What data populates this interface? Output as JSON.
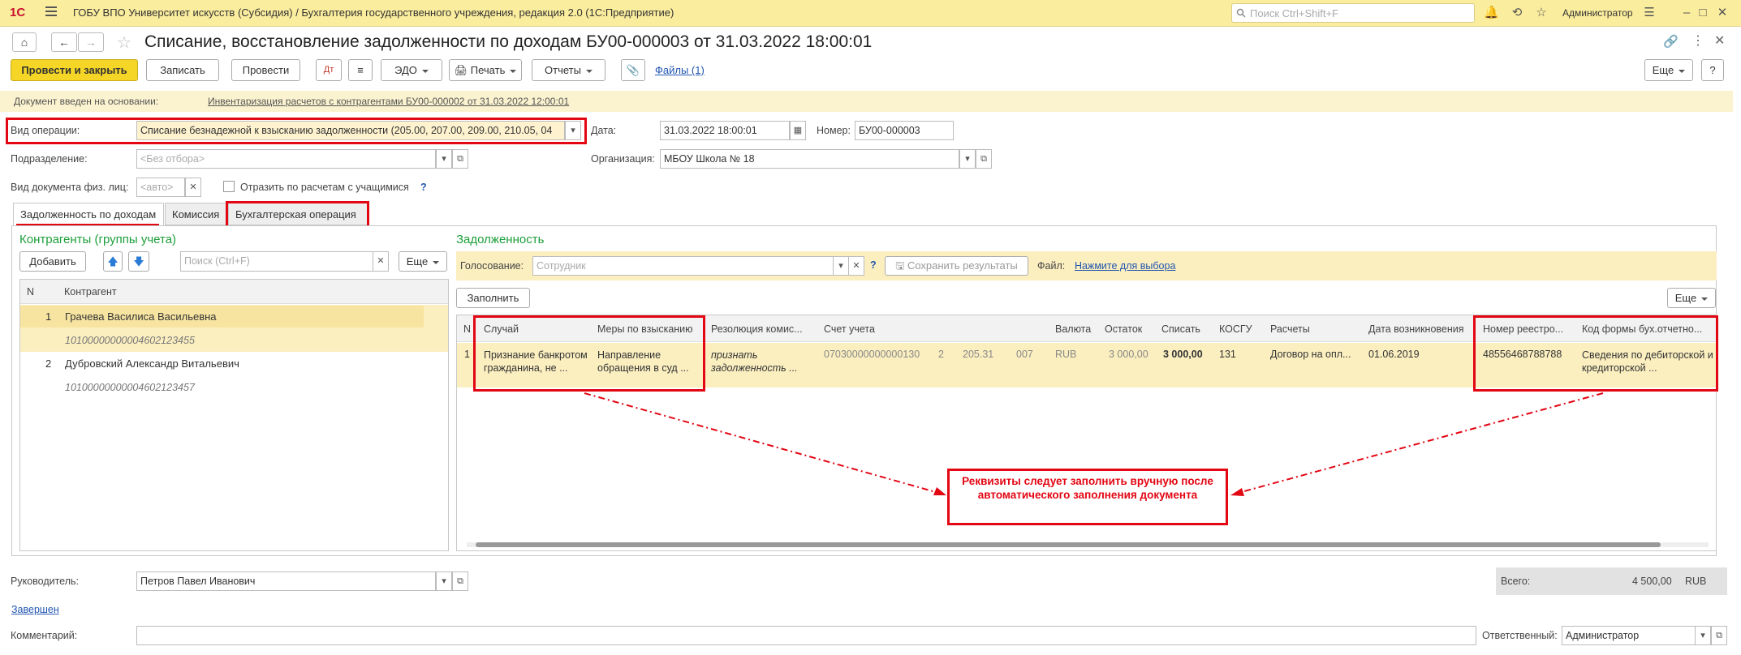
{
  "app": {
    "title": "ГОБУ ВПО Университет искусств (Субсидия) / Бухгалтерия государственного учреждения, редакция 2.0  (1С:Предприятие)",
    "logo": "1С",
    "search_placeholder": "Поиск Ctrl+Shift+F",
    "user": "Администратор"
  },
  "document": {
    "title": "Списание, восстановление задолженности по доходам БУ00-000003 от 31.03.2022 18:00:01"
  },
  "toolbar": {
    "post_close": "Провести и закрыть",
    "save": "Записать",
    "post": "Провести",
    "edo": "ЭДО",
    "print": "Печать",
    "reports": "Отчеты",
    "files": "Файлы (1)",
    "more": "Еще",
    "help": "?"
  },
  "basis": {
    "label": "Документ введен на основании:",
    "link": "Инвентаризация расчетов с контрагентами БУ00-000002 от 31.03.2022 12:00:01"
  },
  "form": {
    "operation_label": "Вид операции:",
    "operation_value": "Списание безнадежной к взысканию задолженности (205.00, 207.00, 209.00, 210.05, 04",
    "date_label": "Дата:",
    "date_value": "31.03.2022 18:00:01",
    "number_label": "Номер:",
    "number_value": "БУ00-000003",
    "division_label": "Подразделение:",
    "division_placeholder": "<Без отбора>",
    "org_label": "Организация:",
    "org_value": "МБОУ Школа № 18",
    "doctype_label": "Вид документа физ. лиц:",
    "doctype_placeholder": "<авто>",
    "reflect_label": "Отразить по расчетам с учащимися",
    "reflect_help": "?"
  },
  "tabs": [
    {
      "label": "Задолженность по доходам"
    },
    {
      "label": "Комиссия"
    },
    {
      "label": "Бухгалтерская операция"
    }
  ],
  "left": {
    "title": "Контрагенты (группы учета)",
    "add": "Добавить",
    "search_placeholder": "Поиск (Ctrl+F)",
    "more": "Еще",
    "col_n": "N",
    "col_contractor": "Контрагент",
    "rows": [
      {
        "n": "1",
        "name": "Грачева Василиса Васильевна",
        "code": "10100000000004602123455"
      },
      {
        "n": "2",
        "name": "Дубровский Александр Витальевич",
        "code": "10100000000004602123457"
      }
    ]
  },
  "right": {
    "title": "Задолженность",
    "voting_label": "Голосование:",
    "voting_placeholder": "Сотрудник",
    "save_results": "Сохранить результаты",
    "file_label": "Файл:",
    "file_link": "Нажмите для выбора",
    "fill": "Заполнить",
    "more": "Еще",
    "columns": [
      "N",
      "Случай",
      "Меры по взысканию",
      "Резолюция комис...",
      "Счет учета",
      "Валюта",
      "Остаток",
      "Списать",
      "КОСГУ",
      "Расчеты",
      "Дата возникновения",
      "Номер реестро...",
      "Код формы бух.отчетно..."
    ],
    "row": {
      "n": "1",
      "case": "Признание банкротом гражданина, не ...",
      "measures": "Направление обращения в суд ...",
      "resolution": "признать задолженность ...",
      "account": "07030000000000130",
      "acc2": "2",
      "acc3": "205.31",
      "acc4": "007",
      "currency": "RUB",
      "balance": "3 000,00",
      "writeoff": "3 000,00",
      "kosgu": "131",
      "settlements": "Договор на опл...",
      "date": "01.06.2019",
      "registry": "48556468788788",
      "form_code": "Сведения по дебиторской и кредиторской ..."
    },
    "note": "Реквизиты следует заполнить вручную после автоматического заполнения документа"
  },
  "footer": {
    "manager_label": "Руководитель:",
    "manager_value": "Петров Павел Иванович",
    "total_label": "Всего:",
    "total_value": "4 500,00",
    "total_currency": "RUB",
    "status": "Завершен",
    "comment_label": "Комментарий:",
    "responsible_label": "Ответственный:",
    "responsible_value": "Администратор"
  }
}
